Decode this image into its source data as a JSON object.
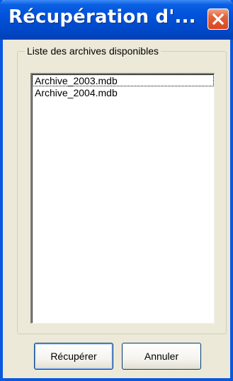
{
  "window": {
    "title": "Récupération d'...",
    "close_icon": "close-icon"
  },
  "group": {
    "label": "Liste des archives disponibles"
  },
  "archives": [
    "Archive_2003.mdb",
    "Archive_2004.mdb"
  ],
  "buttons": {
    "recover_label": "Récupérer",
    "cancel_label": "Annuler"
  },
  "colors": {
    "titlebar": "#0052d9",
    "close_button": "#d8471f",
    "dialog_background": "#ece9d8"
  }
}
